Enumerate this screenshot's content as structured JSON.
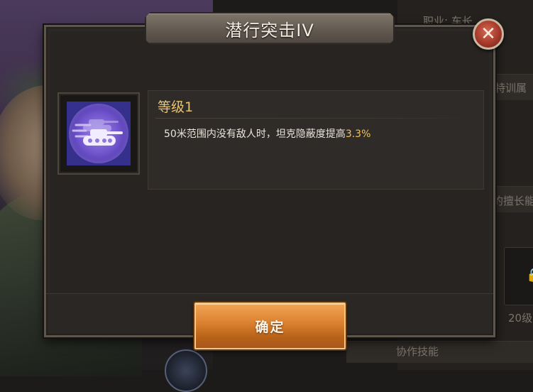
{
  "background": {
    "profession_label": "职业: 车长",
    "attribute_label": "特训属",
    "specialty_label": "的擅长能",
    "level_label": "20级",
    "collab_skill_label": "协作技能"
  },
  "dialog": {
    "title": "潜行突击IV",
    "close_icon": "close-icon",
    "skill_icon": "tank-stealth-icon",
    "level": "等级1",
    "description_prefix": "50米范围内没有敌人时，坦克隐蔽度提高",
    "description_value": "3.3%",
    "confirm_label": "确定"
  },
  "colors": {
    "title_plate": "#6b6258",
    "level_text": "#e8c36f",
    "value_highlight": "#f0c35a",
    "confirm_button": "#d9802e",
    "close_button": "#a5392a",
    "icon_background": "#35308c"
  }
}
